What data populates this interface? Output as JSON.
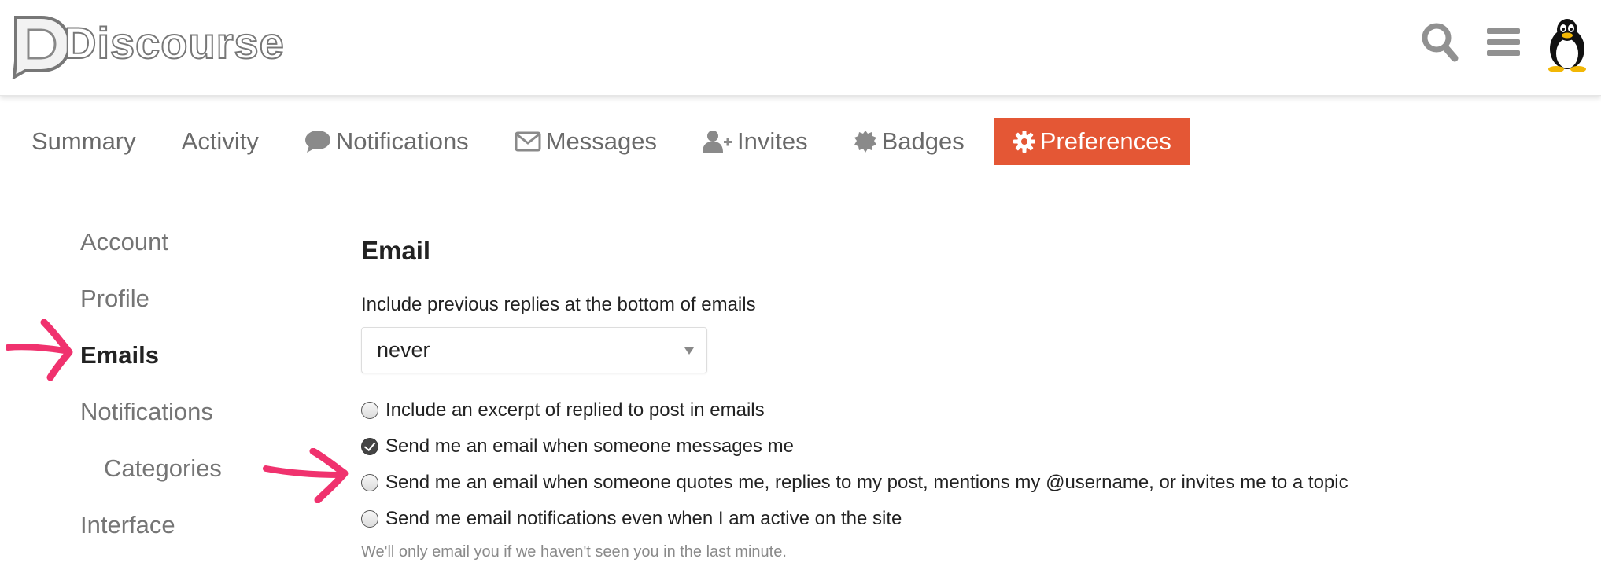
{
  "header": {
    "logo_text": "Discourse",
    "icons": [
      "search-icon",
      "hamburger-menu-icon",
      "user-avatar"
    ]
  },
  "nav": {
    "tabs": [
      {
        "label": "Summary",
        "icon": null
      },
      {
        "label": "Activity",
        "icon": null
      },
      {
        "label": "Notifications",
        "icon": "comment-icon"
      },
      {
        "label": "Messages",
        "icon": "envelope-icon"
      },
      {
        "label": "Invites",
        "icon": "user-plus-icon"
      },
      {
        "label": "Badges",
        "icon": "badge-icon"
      },
      {
        "label": "Preferences",
        "icon": "gear-icon"
      }
    ],
    "active": "Preferences",
    "active_color": "#e45735"
  },
  "side": {
    "items": [
      {
        "label": "Account"
      },
      {
        "label": "Profile"
      },
      {
        "label": "Emails"
      },
      {
        "label": "Notifications"
      },
      {
        "label": "Categories"
      },
      {
        "label": "Interface"
      }
    ],
    "active": "Emails"
  },
  "main": {
    "section_title": "Email",
    "previous_replies_label": "Include previous replies at the bottom of emails",
    "previous_replies_value": "never",
    "options": [
      {
        "label": "Include an excerpt of replied to post in emails",
        "checked": false
      },
      {
        "label": "Send me an email when someone messages me",
        "checked": true
      },
      {
        "label": "Send me an email when someone quotes me, replies to my post, mentions my @username, or invites me to a topic",
        "checked": false
      },
      {
        "label": "Send me email notifications even when I am active on the site",
        "checked": false
      }
    ],
    "hint": "We'll only email you if we haven't seen you in the last minute."
  },
  "annotations": {
    "arrow_color": "#f0326e"
  }
}
